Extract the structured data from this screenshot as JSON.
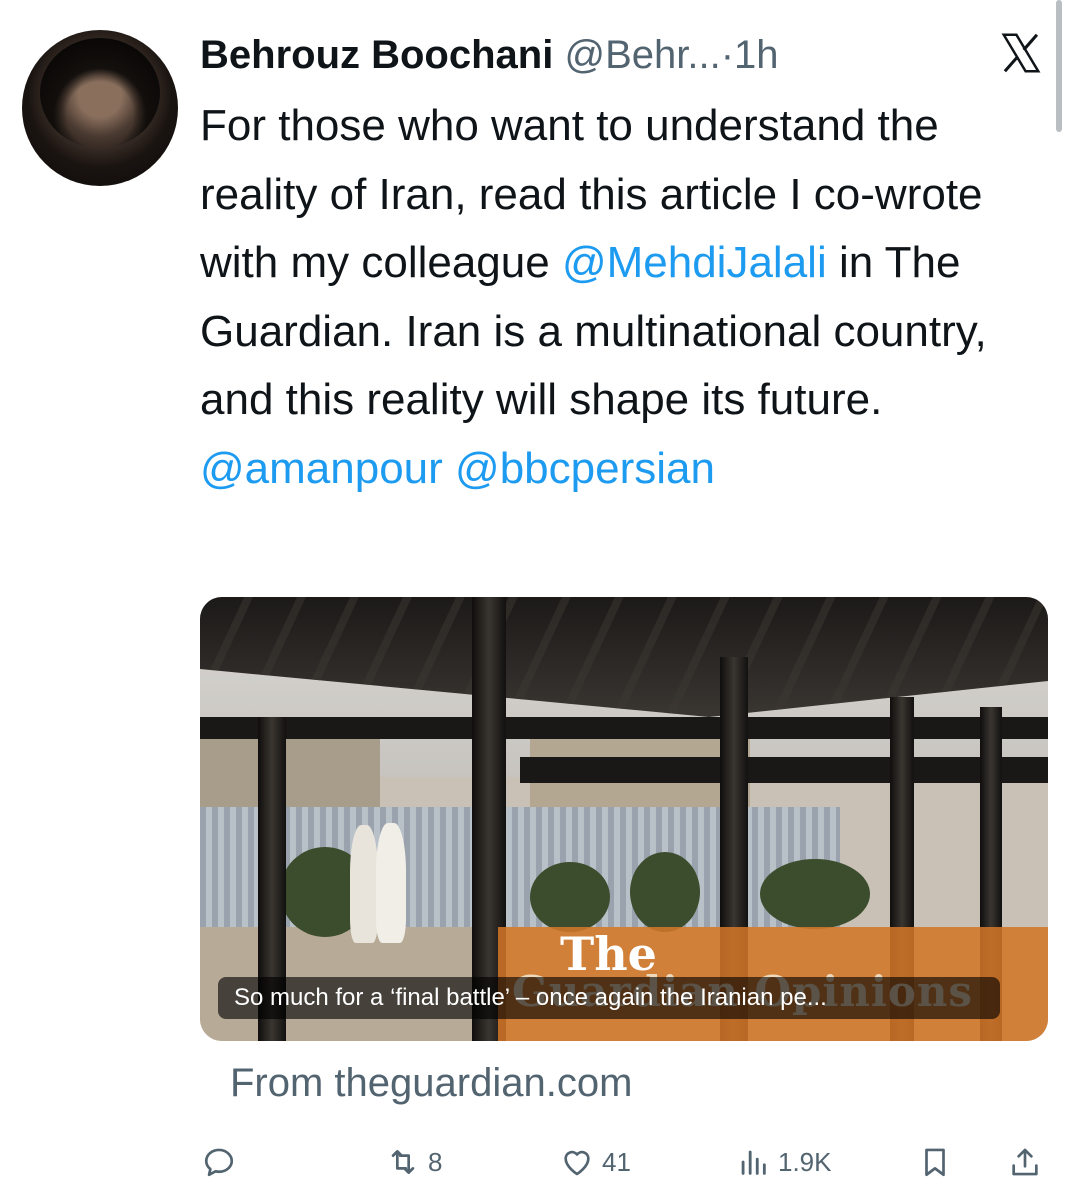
{
  "author": {
    "name": "Behrouz Boochani",
    "handle": "@Behr...",
    "separator": "·",
    "time": "1h",
    "avatar_icon": "profile-photo"
  },
  "platform_logo": "X",
  "tweet": {
    "text_before_mention": "For those who want to understand the reality of Iran, read this article I co-wrote with my colleague ",
    "mention_1": "@MehdiJalali",
    "text_after_mention": " in The Guardian. Iran is a multinational country, and this reality will shape its future.",
    "mention_2": "@amanpour",
    "mention_3": "@bbcpersian"
  },
  "link_card": {
    "brand_line_1": "The",
    "brand_line_2": "Guardian Opinions",
    "caption": "So much for a ‘final battle’ – once again the Iranian pe...",
    "source": "From theguardian.com"
  },
  "actions": {
    "reply_count": "",
    "retweet_count": "8",
    "like_count": "41",
    "views_count": "1.9K"
  },
  "colors": {
    "accent": "#1d9bf0",
    "secondary_text": "#536471",
    "primary_text": "#0f1419"
  }
}
